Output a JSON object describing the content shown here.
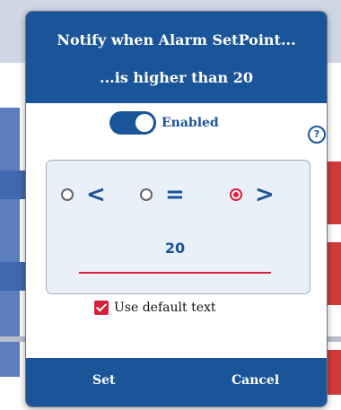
{
  "dialog": {
    "title_line1": "Notify when Alarm SetPoint...",
    "title_line2": "...is higher than 20"
  },
  "toggle": {
    "label": "Enabled",
    "state": "on"
  },
  "help": {
    "icon": "help-circle-icon",
    "glyph": "?"
  },
  "comparison": {
    "options": [
      {
        "symbol": "<",
        "selected": false
      },
      {
        "symbol": "=",
        "selected": false
      },
      {
        "symbol": ">",
        "selected": true
      }
    ],
    "value": "20"
  },
  "default_text": {
    "label": "Use default text",
    "checked": true
  },
  "buttons": {
    "set": "Set",
    "cancel": "Cancel"
  },
  "colors": {
    "primary": "#1a5599",
    "accent": "#d61f3b"
  }
}
